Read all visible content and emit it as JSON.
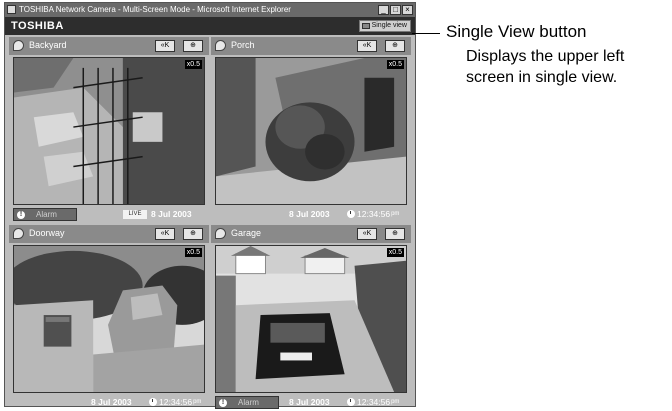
{
  "window": {
    "title": "TOSHIBA Network Camera - Multi-Screen Mode - Microsoft Internet Explorer",
    "controls": [
      "_",
      "□",
      "×"
    ]
  },
  "header": {
    "brand": "TOSHIBA",
    "single_view_label": "Single view",
    "single_view_icon": "single-view-icon"
  },
  "panels": [
    {
      "name": "Backyard",
      "zoom": "x0.5",
      "controls": [
        "«K",
        "⊕"
      ],
      "footer": {
        "alarm_label": "Alarm",
        "live_label": "LIVE",
        "date": "8 Jul 2003",
        "time": "",
        "ampm": ""
      }
    },
    {
      "name": "Porch",
      "zoom": "x0.5",
      "controls": [
        "«K",
        "⊕"
      ],
      "footer": {
        "alarm_label": "",
        "live_label": "",
        "date": "8 Jul 2003",
        "time": "12:34:56",
        "ampm": "pm"
      }
    },
    {
      "name": "Doorway",
      "zoom": "x0.5",
      "controls": [
        "«K",
        "⊕"
      ],
      "footer": {
        "alarm_label": "",
        "live_label": "",
        "date": "8 Jul 2003",
        "time": "12:34:56",
        "ampm": "pm"
      }
    },
    {
      "name": "Garage",
      "zoom": "x0.5",
      "controls": [
        "«K",
        "⊕"
      ],
      "footer": {
        "alarm_label": "Alarm",
        "live_label": "",
        "date": "8 Jul 2003",
        "time": "12:34:56",
        "ampm": "pm"
      }
    }
  ],
  "annotation": {
    "title": "Single View button",
    "body": "Displays the upper left screen in single view."
  },
  "colors": {
    "title_bar": "#6a6a6a",
    "brand_bar": "#2d2d2d",
    "panel_header": "#8a8a8a",
    "window_bg": "#bdbdbd"
  }
}
